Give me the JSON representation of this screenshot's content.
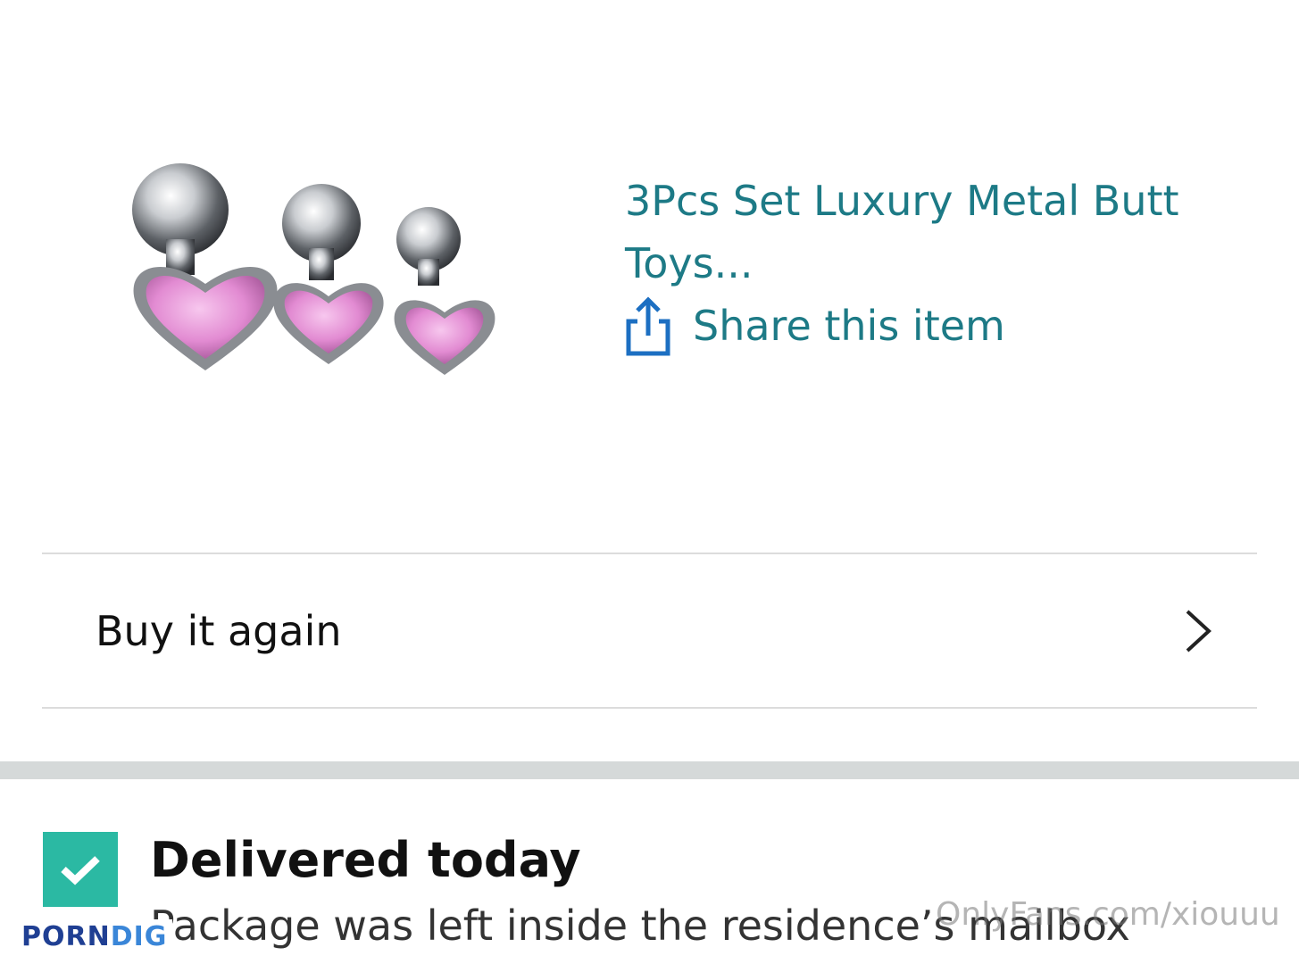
{
  "product": {
    "title": "3Pcs Set Luxury Metal Butt Toys...",
    "share_label": "Share this item",
    "image_alt": "product-image"
  },
  "buy_again": {
    "label": "Buy it again"
  },
  "delivery": {
    "status": "Delivered today",
    "detail": "Package was left inside the residence’s mailbox"
  },
  "watermarks": {
    "onlyfans": "OnlyFans.com/xiouuu",
    "porndig_a": "PORN",
    "porndig_b": "DIG"
  },
  "colors": {
    "link": "#1d7a86",
    "share_icon": "#1c6fc2",
    "check": "#2bb9a3",
    "divider": "#dcdcdc"
  },
  "icons": {
    "share": "share-icon",
    "chevron": "chevron-right-icon",
    "check": "check-icon"
  }
}
